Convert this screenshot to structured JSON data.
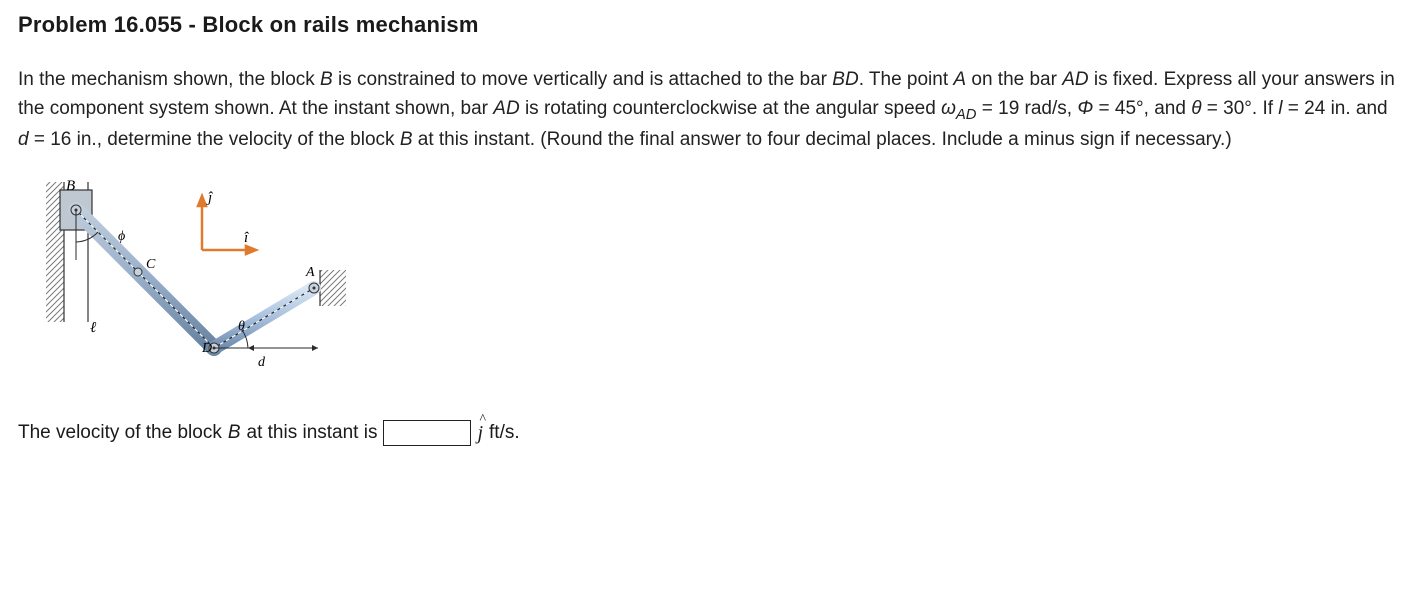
{
  "title": "Problem 16.055 - Block on rails mechanism",
  "desc_parts": {
    "p1": "In the mechanism shown, the block ",
    "B1": "B",
    "p2": " is constrained to move vertically and is attached to the bar ",
    "BD": "BD",
    "p3": ". The point ",
    "A1": "A",
    "p4": " on the bar ",
    "AD1": "AD",
    "p5": " is fixed. Express all your answers in the component system shown. At the instant shown, bar ",
    "AD2": "AD",
    "p6": " is rotating counterclockwise at the angular speed ",
    "omega": "ω",
    "omega_sub": "AD",
    "eq1": " = 19 rad/s, ",
    "phi": "Φ",
    "eq2": " = 45°, and ",
    "theta": "θ",
    "eq3": " = 30°. If ",
    "l": "l",
    "eq4": " = 24 in. and ",
    "d": "d",
    "eq5": " = 16 in., determine the velocity of the block ",
    "B2": "B",
    "p7": " at this instant. (Round the final answer to four decimal places. Include a minus sign if necessary.)"
  },
  "answer": {
    "prefix": "The velocity of the block ",
    "B": "B",
    "mid": " at this instant is ",
    "unit_symbol": "j",
    "unit_suffix": "  ft/s."
  },
  "diagram_labels": {
    "B": "B",
    "C": "C",
    "D": "D",
    "A": "A",
    "l": "ℓ",
    "d": "d",
    "phi": "ϕ",
    "theta": "θ",
    "j": "ĵ",
    "i": "î"
  }
}
